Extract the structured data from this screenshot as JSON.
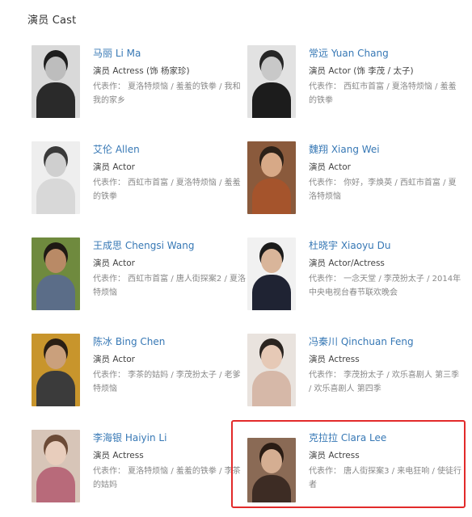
{
  "section_title": "演员 Cast",
  "cast": [
    {
      "name": "马丽 Li Ma",
      "role": "演员 Actress (饰 杨家珍)",
      "works": "代表作： 夏洛特烦恼 / 羞羞的铁拳 / 我和我的家乡",
      "colors": {
        "bg": "#d9d9d9",
        "hair": "#1e1e1e",
        "skin": "#bdbdbd",
        "cloth": "#2a2a2a"
      }
    },
    {
      "name": "常远 Yuan Chang",
      "role": "演员 Actor (饰 李茂 / 太子)",
      "works": "代表作： 西虹市首富 / 夏洛特烦恼 / 羞羞的铁拳",
      "colors": {
        "bg": "#e2e2e2",
        "hair": "#262626",
        "skin": "#c8c8c8",
        "cloth": "#1c1c1c"
      }
    },
    {
      "name": "艾伦 Allen",
      "role": "演员 Actor",
      "works": "代表作： 西虹市首富 / 夏洛特烦恼 / 羞羞的铁拳",
      "colors": {
        "bg": "#eeeeee",
        "hair": "#3a3a3a",
        "skin": "#cfcfcf",
        "cloth": "#d8d8d8"
      }
    },
    {
      "name": "魏翔 Xiang Wei",
      "role": "演员 Actor",
      "works": "代表作： 你好，李焕英 / 西虹市首富 / 夏洛特烦恼",
      "colors": {
        "bg": "#8a5a3c",
        "hair": "#2c2118",
        "skin": "#d7a987",
        "cloth": "#a5542c"
      }
    },
    {
      "name": "王成思 Chengsi Wang",
      "role": "演员 Actor",
      "works": "代表作： 西虹市首富 / 唐人街探案2 / 夏洛特烦恼",
      "colors": {
        "bg": "#6f8a3e",
        "hair": "#1f1a14",
        "skin": "#b98a66",
        "cloth": "#5b6d88"
      }
    },
    {
      "name": "杜晓宇 Xiaoyu Du",
      "role": "演员 Actor/Actress",
      "works": "代表作： 一念天堂 / 李茂扮太子 / 2014年中央电视台春节联欢晚会",
      "colors": {
        "bg": "#f1f1f1",
        "hair": "#1b1b1b",
        "skin": "#d9b59a",
        "cloth": "#1f2333"
      }
    },
    {
      "name": "陈冰 Bing Chen",
      "role": "演员 Actor",
      "works": "代表作： 李茶的姑妈 / 李茂扮太子 / 老爹特烦恼",
      "colors": {
        "bg": "#c8952c",
        "hair": "#2a1f14",
        "skin": "#caa07c",
        "cloth": "#3b3b3b"
      }
    },
    {
      "name": "冯秦川 Qinchuan Feng",
      "role": "演员 Actress",
      "works": "代表作： 李茂扮太子 / 欢乐喜剧人 第三季 / 欢乐喜剧人 第四季",
      "colors": {
        "bg": "#e9e3de",
        "hair": "#2a2420",
        "skin": "#e6c9b6",
        "cloth": "#d6b8a8"
      }
    },
    {
      "name": "李海银 Haiyin Li",
      "role": "演员 Actress",
      "works": "代表作： 夏洛特烦恼 / 羞羞的铁拳 / 李茶的姑妈",
      "colors": {
        "bg": "#d7c5b8",
        "hair": "#6b4a36",
        "skin": "#e8cdbc",
        "cloth": "#b86a7a"
      }
    },
    {
      "name": "克拉拉 Clara Lee",
      "role": "演员 Actress",
      "works": "代表作： 唐人街探案3 / 来电狂响 / 使徒行者",
      "colors": {
        "bg": "#8a6a55",
        "hair": "#2a1c14",
        "skin": "#d5ae92",
        "cloth": "#3d2c24"
      }
    }
  ],
  "highlight": {
    "target": "克拉拉 Clara Lee",
    "color": "#e22a2a"
  }
}
